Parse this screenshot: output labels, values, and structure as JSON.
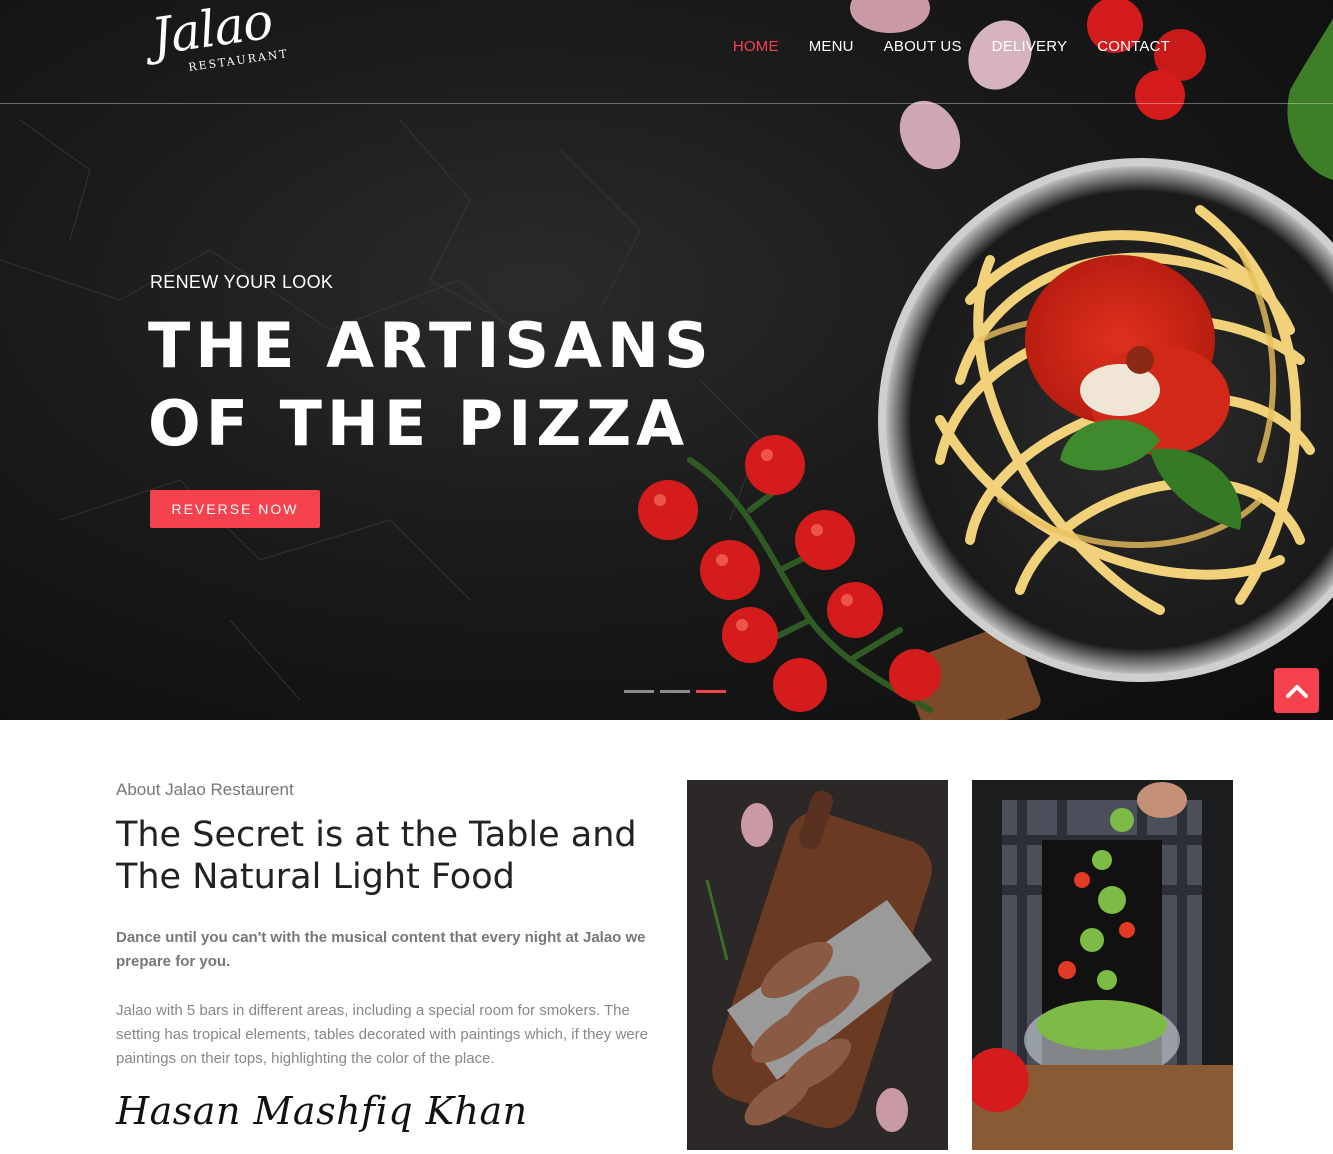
{
  "brand": {
    "logo_script": "Jalao",
    "logo_sub": "RESTAURANT"
  },
  "nav": {
    "items": [
      {
        "label": "HOME",
        "active": true
      },
      {
        "label": "MENU",
        "active": false
      },
      {
        "label": "ABOUT US",
        "active": false
      },
      {
        "label": "DELIVERY",
        "active": false
      },
      {
        "label": "CONTACT",
        "active": false
      }
    ]
  },
  "hero": {
    "eyebrow": "RENEW YOUR LOOK",
    "headline_line1": "THE ARTISANS",
    "headline_line2": "OF THE PIZZA",
    "cta_label": "REVERSE NOW",
    "slides_total": 3,
    "active_slide": 3
  },
  "about": {
    "kicker": "About Jalao Restaurent",
    "title_line1": "The Secret is at the Table and",
    "title_line2": "The Natural Light Food",
    "bold_text": "Dance until you can't with the musical content that every night at Jalao we prepare for you.",
    "body_text": "Jalao with 5 bars in different areas, including a special room for smokers. The setting has tropical elements, tables decorated with paintings which, if they were paintings on their tops, highlighting the color of the place.",
    "signature": "Hasan Mashfiq Khan"
  },
  "icons": {
    "scroll_top": "chevron-up-icon"
  },
  "colors": {
    "accent": "#f5424e",
    "hero_bg": "#1a1a1a",
    "text_dark": "#222222",
    "text_muted": "#888888"
  }
}
